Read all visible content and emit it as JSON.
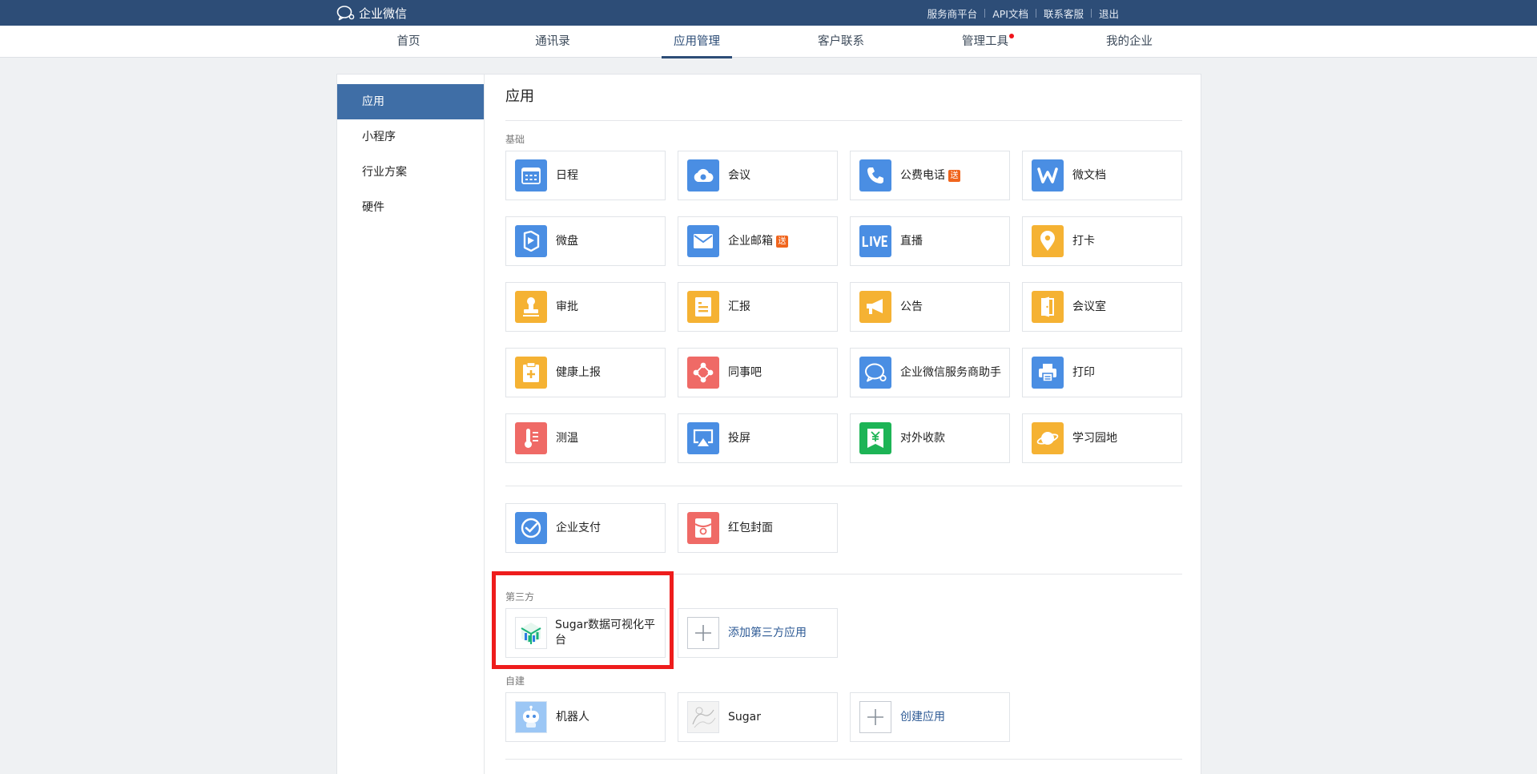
{
  "header": {
    "logo_text": "企业微信",
    "links": [
      "服务商平台",
      "API文档",
      "联系客服",
      "退出"
    ]
  },
  "nav": {
    "tabs": [
      {
        "label": "首页"
      },
      {
        "label": "通讯录"
      },
      {
        "label": "应用管理",
        "active": true
      },
      {
        "label": "客户联系"
      },
      {
        "label": "管理工具",
        "dot": true
      },
      {
        "label": "我的企业"
      }
    ]
  },
  "sidebar": {
    "items": [
      {
        "label": "应用",
        "active": true
      },
      {
        "label": "小程序"
      },
      {
        "label": "行业方案"
      },
      {
        "label": "硬件"
      }
    ]
  },
  "main": {
    "title": "应用",
    "basic": {
      "label": "基础",
      "apps": [
        {
          "label": "日程",
          "icon": "calendar-icon",
          "color": "#4a8ee3"
        },
        {
          "label": "会议",
          "icon": "meeting-cloud-icon",
          "color": "#4a8ee3"
        },
        {
          "label": "公费电话",
          "icon": "phone-icon",
          "color": "#4a8ee3",
          "badge": "送"
        },
        {
          "label": "微文档",
          "icon": "w-doc-icon",
          "color": "#4a8ee3"
        },
        {
          "label": "微盘",
          "icon": "drive-icon",
          "color": "#4a8ee3"
        },
        {
          "label": "企业邮箱",
          "icon": "mail-icon",
          "color": "#4a8ee3",
          "badge": "送"
        },
        {
          "label": "直播",
          "icon": "live-icon",
          "color": "#4a8ee3"
        },
        {
          "label": "打卡",
          "icon": "location-pin-icon",
          "color": "#f5b233"
        },
        {
          "label": "审批",
          "icon": "stamp-icon",
          "color": "#f5b233"
        },
        {
          "label": "汇报",
          "icon": "report-icon",
          "color": "#f5b233"
        },
        {
          "label": "公告",
          "icon": "megaphone-icon",
          "color": "#f5b233"
        },
        {
          "label": "会议室",
          "icon": "door-icon",
          "color": "#f5b233"
        },
        {
          "label": "健康上报",
          "icon": "health-report-icon",
          "color": "#f5b233"
        },
        {
          "label": "同事吧",
          "icon": "colleague-network-icon",
          "color": "#ef6a66"
        },
        {
          "label": "企业微信服务商助手",
          "icon": "service-chat-icon",
          "color": "#4a8ee3"
        },
        {
          "label": "打印",
          "icon": "printer-icon",
          "color": "#4a8ee3"
        },
        {
          "label": "测温",
          "icon": "thermometer-icon",
          "color": "#ef6a66"
        },
        {
          "label": "投屏",
          "icon": "screen-cast-icon",
          "color": "#4a8ee3"
        },
        {
          "label": "对外收款",
          "icon": "yuan-payment-icon",
          "color": "#1db456"
        },
        {
          "label": "学习园地",
          "icon": "planet-icon",
          "color": "#f5b233"
        }
      ]
    },
    "pay": {
      "apps": [
        {
          "label": "企业支付",
          "icon": "pay-check-icon",
          "color": "#4a8ee3"
        },
        {
          "label": "红包封面",
          "icon": "red-packet-icon",
          "color": "#ef6a66"
        }
      ]
    },
    "third_party": {
      "label": "第三方",
      "apps": [
        {
          "label": "Sugar数据可视化平台",
          "icon": "sugar-cube-icon"
        }
      ],
      "add_label": "添加第三方应用"
    },
    "custom": {
      "label": "自建",
      "apps": [
        {
          "label": "机器人",
          "icon": "robot-icon"
        },
        {
          "label": "Sugar",
          "icon": "sugar-sketch-icon"
        }
      ],
      "create_label": "创建应用"
    }
  },
  "colors": {
    "topbar": "#2d4d77",
    "sidebar_active": "#3f6ea6",
    "link": "#2d5a95",
    "highlight": "#ee1c1c"
  }
}
